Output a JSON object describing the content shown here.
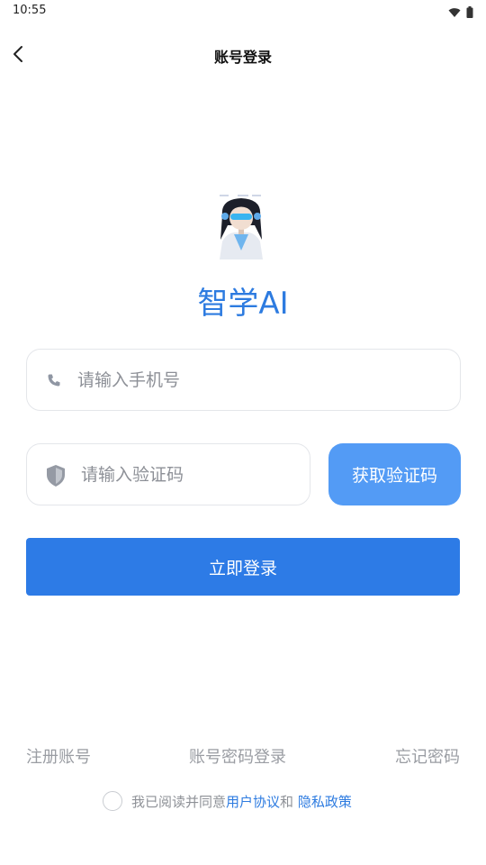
{
  "status_bar": {
    "time": "10:55"
  },
  "nav": {
    "title": "账号登录"
  },
  "app": {
    "name": "智学AI"
  },
  "phone_input": {
    "placeholder": "请输入手机号",
    "value": ""
  },
  "code_input": {
    "placeholder": "请输入验证码",
    "value": ""
  },
  "buttons": {
    "get_code": "获取验证码",
    "login": "立即登录"
  },
  "links": {
    "register": "注册账号",
    "password_login": "账号密码登录",
    "forgot_password": "忘记密码"
  },
  "agreement": {
    "prefix": "我已阅读并同意",
    "user_agreement": "用户协议",
    "and": "和 ",
    "privacy_policy": "隐私政策",
    "checked": false
  },
  "colors": {
    "accent": "#2d7be6",
    "accent_light": "#539bf5",
    "muted_text": "#9a9da3"
  },
  "icons": [
    "wifi-icon",
    "battery-icon",
    "back-arrow-icon",
    "phone-icon",
    "shield-icon"
  ]
}
